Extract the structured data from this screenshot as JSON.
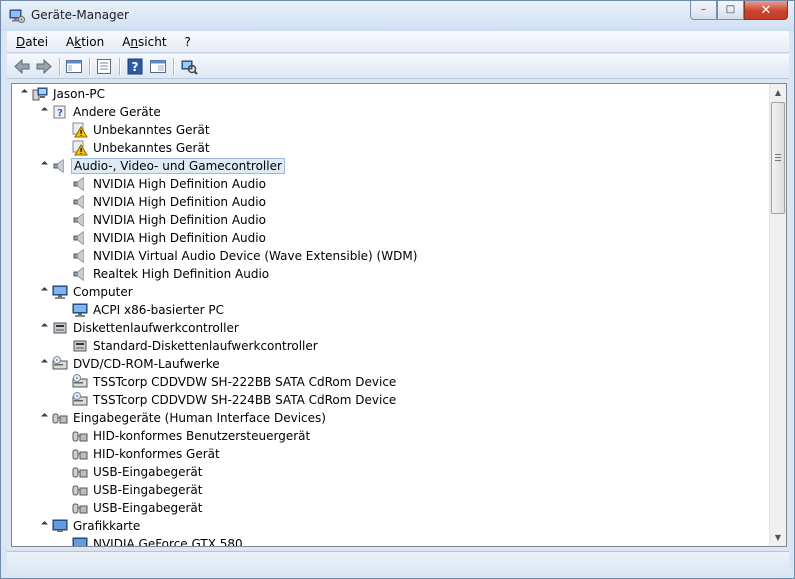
{
  "window": {
    "title": "Geräte-Manager",
    "controls": {
      "minimize": "–",
      "maximize": "□",
      "close": "✕"
    }
  },
  "menu": [
    {
      "label": "Datei",
      "key": "D",
      "rest": "atei"
    },
    {
      "label": "Aktion",
      "key": "k",
      "pre": "A",
      "rest": "tion"
    },
    {
      "label": "Ansicht",
      "key": "n",
      "pre": "A",
      "rest": "sicht"
    },
    {
      "label": "?",
      "key": "?"
    }
  ],
  "toolbar": {
    "buttons": [
      "back-icon",
      "forward-icon",
      "show-hide-tree-icon",
      "properties-icon",
      "help-icon",
      "view-icon",
      "scan-hardware-icon"
    ]
  },
  "tree": [
    {
      "label": "Jason-PC",
      "level": 0,
      "icon": "pc",
      "expanded": true
    },
    {
      "label": "Andere Geräte",
      "level": 1,
      "icon": "unknown",
      "expanded": true
    },
    {
      "label": "Unbekanntes Gerät",
      "level": 2,
      "icon": "warning"
    },
    {
      "label": "Unbekanntes Gerät",
      "level": 2,
      "icon": "warning"
    },
    {
      "label": "Audio-, Video- und Gamecontroller",
      "level": 1,
      "icon": "speaker",
      "expanded": true,
      "selected": true
    },
    {
      "label": "NVIDIA High Definition Audio",
      "level": 2,
      "icon": "speaker"
    },
    {
      "label": "NVIDIA High Definition Audio",
      "level": 2,
      "icon": "speaker"
    },
    {
      "label": "NVIDIA High Definition Audio",
      "level": 2,
      "icon": "speaker"
    },
    {
      "label": "NVIDIA High Definition Audio",
      "level": 2,
      "icon": "speaker"
    },
    {
      "label": "NVIDIA Virtual Audio Device (Wave Extensible) (WDM)",
      "level": 2,
      "icon": "speaker"
    },
    {
      "label": "Realtek High Definition Audio",
      "level": 2,
      "icon": "speaker"
    },
    {
      "label": "Computer",
      "level": 1,
      "icon": "computer",
      "expanded": true
    },
    {
      "label": "ACPI x86-basierter PC",
      "level": 2,
      "icon": "computer"
    },
    {
      "label": "Diskettenlaufwerkcontroller",
      "level": 1,
      "icon": "floppy",
      "expanded": true
    },
    {
      "label": "Standard-Diskettenlaufwerkcontroller",
      "level": 2,
      "icon": "floppy"
    },
    {
      "label": "DVD/CD-ROM-Laufwerke",
      "level": 1,
      "icon": "dvd",
      "expanded": true
    },
    {
      "label": "TSSTcorp CDDVDW SH-222BB SATA CdRom Device",
      "level": 2,
      "icon": "dvd"
    },
    {
      "label": "TSSTcorp CDDVDW SH-224BB SATA CdRom Device",
      "level": 2,
      "icon": "dvd"
    },
    {
      "label": "Eingabegeräte (Human Interface Devices)",
      "level": 1,
      "icon": "hid",
      "expanded": true
    },
    {
      "label": "HID-konformes Benutzersteuergerät",
      "level": 2,
      "icon": "hid"
    },
    {
      "label": "HID-konformes Gerät",
      "level": 2,
      "icon": "hid"
    },
    {
      "label": "USB-Eingabegerät",
      "level": 2,
      "icon": "hid"
    },
    {
      "label": "USB-Eingabegerät",
      "level": 2,
      "icon": "hid"
    },
    {
      "label": "USB-Eingabegerät",
      "level": 2,
      "icon": "hid"
    },
    {
      "label": "Grafikkarte",
      "level": 1,
      "icon": "monitor",
      "expanded": true
    },
    {
      "label": "NVIDIA GeForce GTX 580",
      "level": 2,
      "icon": "monitor"
    }
  ],
  "colors": {
    "selection_bg": "#dfeaf7",
    "selection_border": "#9cb8dc",
    "close_button": "#c9452f"
  }
}
